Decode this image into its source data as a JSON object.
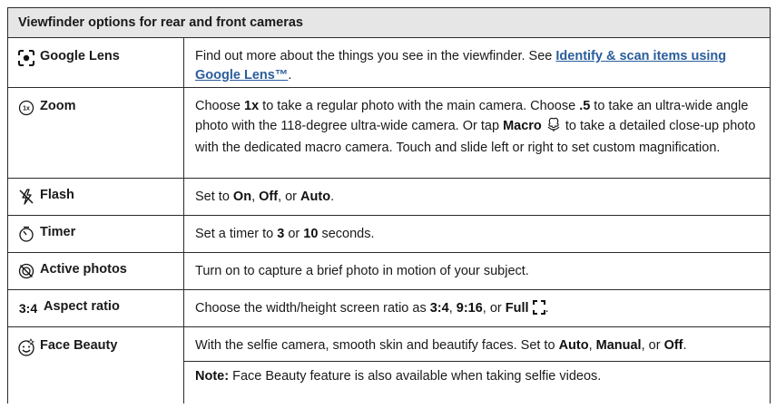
{
  "header": "Viewfinder options for rear and front cameras",
  "rows": [
    {
      "label": "Google Lens",
      "icon": "google-lens-icon",
      "desc_a": "Find out more about the things you see in the viewfinder. See ",
      "link": "Identify & scan items using Google Lens™",
      "desc_b": "."
    },
    {
      "label": "Zoom",
      "icon": "zoom-1x-icon",
      "icon_text": "1x",
      "t1": "Choose ",
      "b1": "1x",
      "t2": " to take a regular photo with the main camera. Choose ",
      "b2": ".5",
      "t3": " to take an ultra-wide angle photo with the 118-degree ultra-wide camera. Or tap ",
      "b3": "Macro",
      "t4": " to take a detailed close-up photo with the dedicated macro camera. Touch and slide left or right to set custom magnification."
    },
    {
      "label": "Flash",
      "icon": "flash-off-icon",
      "t1": "Set to ",
      "b1": "On",
      "t2": ", ",
      "b2": "Off",
      "t3": ", or ",
      "b3": "Auto",
      "t4": "."
    },
    {
      "label": "Timer",
      "icon": "timer-icon",
      "t1": "Set a timer to ",
      "b1": "3",
      "t2": " or ",
      "b2": "10",
      "t3": " seconds."
    },
    {
      "label": "Active photos",
      "icon": "active-photos-off-icon",
      "t1": "Turn on to capture a brief photo in motion of your subject."
    },
    {
      "label": "Aspect ratio",
      "icon": "aspect-ratio-icon",
      "icon_text": "3:4",
      "t1": "Choose the width/height screen ratio as ",
      "b1": "3:4",
      "t2": ", ",
      "b2": "9:16",
      "t3": ", or ",
      "b3": "Full",
      "t4": "."
    },
    {
      "label": "Face Beauty",
      "icon": "face-beauty-icon",
      "t1": "With the selfie camera, smooth skin and beautify faces. Set to ",
      "b1": "Auto",
      "t2": ", ",
      "b2": "Manual",
      "t3": ", or ",
      "b3": "Off",
      "t4": ".",
      "note_label": "Note:",
      "note_text": " Face Beauty feature is also available when taking selfie videos."
    }
  ]
}
